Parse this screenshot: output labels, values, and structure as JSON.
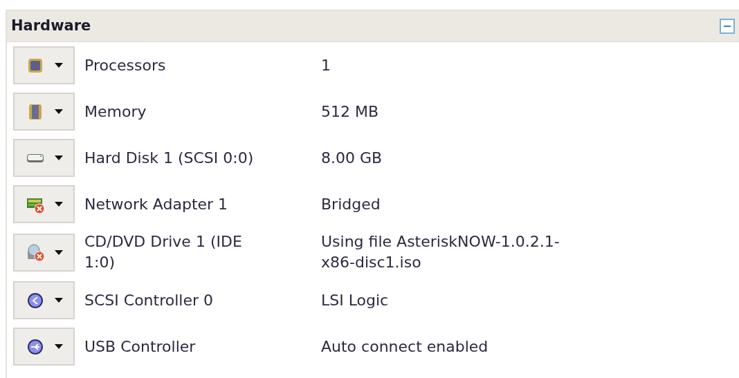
{
  "panel": {
    "title": "Hardware",
    "expanded": true
  },
  "devices": [
    {
      "kind": "cpu",
      "label": "Processors",
      "value": "1",
      "disconnected": false
    },
    {
      "kind": "memory",
      "label": "Memory",
      "value": "512 MB",
      "disconnected": false
    },
    {
      "kind": "disk",
      "label": "Hard Disk 1 (SCSI 0:0)",
      "value": "8.00 GB",
      "disconnected": false
    },
    {
      "kind": "network",
      "label": "Network Adapter 1",
      "value": "Bridged",
      "disconnected": true
    },
    {
      "kind": "cdrom",
      "label": "CD/DVD Drive 1 (IDE 1:0)",
      "value": "Using file AsteriskNOW-1.0.2.1-x86-disc1.iso",
      "disconnected": true
    },
    {
      "kind": "scsi",
      "label": "SCSI Controller 0",
      "value": "LSI Logic",
      "disconnected": false
    },
    {
      "kind": "usb",
      "label": "USB Controller",
      "value": "Auto connect enabled",
      "disconnected": false
    }
  ]
}
